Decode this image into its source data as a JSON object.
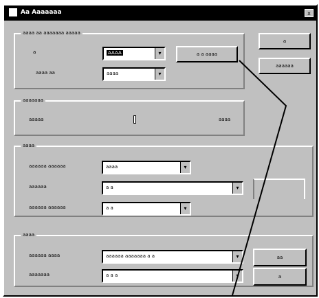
{
  "window": {
    "title": "Aa Aaaaaaa",
    "close_glyph": "x"
  },
  "group_top": {
    "legend": "aaaa aa aaaaaaa aaaaa",
    "row1_label": "a",
    "row1_value": "AAAA",
    "row1_button": "a a aaaa",
    "row2_label": "aaaa aa",
    "row2_value": "aaaa"
  },
  "buttons": {
    "ok": "a",
    "cancel": "aaaaaa"
  },
  "group_slider": {
    "legend": "aaaaaaa",
    "left_label": "aaaaa",
    "right_label": "aaaa"
  },
  "group_middle": {
    "legend": "aaaa",
    "row1_label": "aaaaaa aaaaaa",
    "row1_value": "aaaa",
    "row2_label": "aaaaaa",
    "row2_value": "a a",
    "row3_label": "aaaaaa aaaaaa",
    "row3_value": "a a"
  },
  "group_bottom": {
    "legend": "aaaa",
    "row1_label": "aaaaaa aaaa",
    "row1_value": "aaaaaa aaaaaaa a a",
    "row2_label": "aaaaaaa",
    "row2_value": "a a a",
    "btn1": "aa",
    "btn2": "a"
  },
  "icons": {
    "dropdown": "▾"
  }
}
